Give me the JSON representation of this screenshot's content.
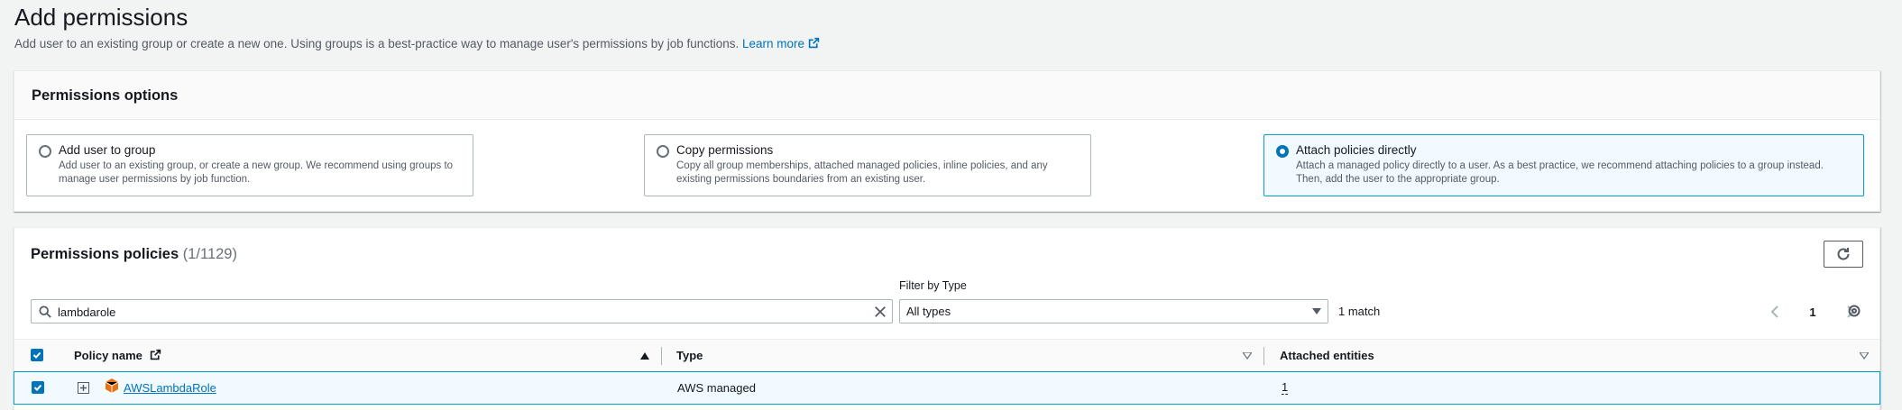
{
  "page": {
    "title": "Add permissions",
    "description": "Add user to an existing group or create a new one. Using groups is a best-practice way to manage user's permissions by job functions.",
    "learn_more": "Learn more"
  },
  "options": {
    "header": "Permissions options",
    "cards": [
      {
        "title": "Add user to group",
        "desc": "Add user to an existing group, or create a new group. We recommend using groups to manage user permissions by job function.",
        "selected": false
      },
      {
        "title": "Copy permissions",
        "desc": "Copy all group memberships, attached managed policies, inline policies, and any existing permissions boundaries from an existing user.",
        "selected": false
      },
      {
        "title": "Attach policies directly",
        "desc": "Attach a managed policy directly to a user. As a best practice, we recommend attaching policies to a group instead. Then, add the user to the appropriate group.",
        "selected": true
      }
    ]
  },
  "policies": {
    "header": "Permissions policies",
    "count": "(1/1129)",
    "search_value": "lambdarole",
    "filter_label": "Filter by Type",
    "filter_value": "All types",
    "match_count": "1 match",
    "page_number": "1",
    "columns": {
      "name": "Policy name",
      "type": "Type",
      "attached": "Attached entities"
    },
    "rows": [
      {
        "name": "AWSLambdaRole",
        "type": "AWS managed",
        "attached": "1",
        "checked": true
      }
    ]
  },
  "colors": {
    "accent": "#0073bb",
    "selected_bg": "#f1faff",
    "selected_border": "#00a1c9",
    "package_icon": "#ec7211"
  }
}
